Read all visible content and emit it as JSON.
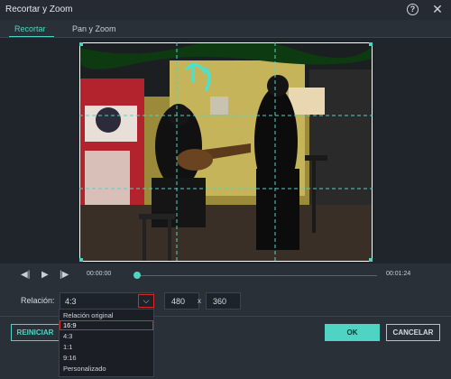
{
  "window": {
    "title": "Recortar y Zoom",
    "help_icon": "question-circle-icon",
    "help_glyph": "?",
    "close_icon": "close-icon",
    "close_glyph": "✕"
  },
  "tabs": [
    {
      "label": "Recortar",
      "active": true
    },
    {
      "label": "Pan y Zoom",
      "active": false
    }
  ],
  "player": {
    "current_time": "00:00:00",
    "total_time": "00:01:24",
    "progress": 0.0,
    "prev_icon": "step-back-icon",
    "prev_glyph": "◀|",
    "play_icon": "play-icon",
    "play_glyph": "▶",
    "next_icon": "step-forward-icon",
    "next_glyph": "|▶"
  },
  "ratio": {
    "label": "Relación:",
    "selected": "4:3",
    "arrow_glyph": "⌵",
    "width": "480",
    "separator": "x",
    "height": "360",
    "options": [
      "Relación original",
      "16:9",
      "4:3",
      "1:1",
      "9:16",
      "Personalizado"
    ],
    "highlighted_index": 1
  },
  "buttons": {
    "reset": "REINICIAR",
    "ok": "OK",
    "cancel": "CANCELAR"
  },
  "colors": {
    "accent": "#4fd4c3",
    "highlight": "#d42b2b",
    "background": "#2a3038"
  }
}
